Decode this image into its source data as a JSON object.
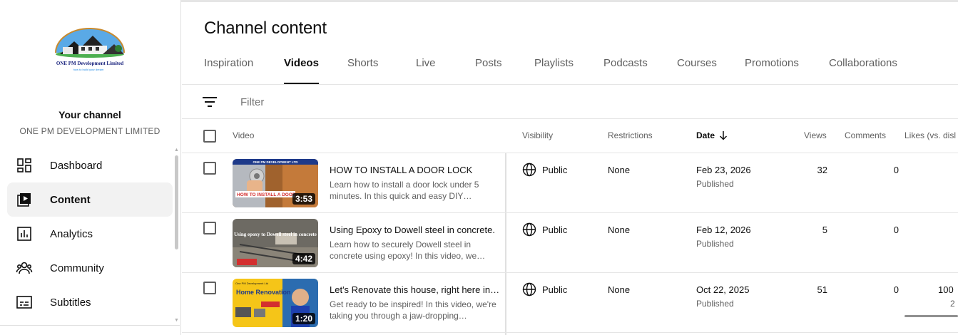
{
  "sidebar": {
    "logo_text": "ONE PM Development Limited",
    "logo_tagline": "how to build your dream",
    "your_channel_label": "Your channel",
    "channel_name": "ONE PM DEVELOPMENT LIMITED",
    "items": [
      {
        "label": "Dashboard",
        "icon": "dashboard-icon",
        "active": false
      },
      {
        "label": "Content",
        "icon": "content-icon",
        "active": true
      },
      {
        "label": "Analytics",
        "icon": "analytics-icon",
        "active": false
      },
      {
        "label": "Community",
        "icon": "community-icon",
        "active": false
      },
      {
        "label": "Subtitles",
        "icon": "subtitles-icon",
        "active": false
      }
    ]
  },
  "main": {
    "title": "Channel content",
    "tabs": [
      {
        "label": "Inspiration",
        "active": false
      },
      {
        "label": "Videos",
        "active": true
      },
      {
        "label": "Shorts",
        "active": false
      },
      {
        "label": "Live",
        "active": false
      },
      {
        "label": "Posts",
        "active": false
      },
      {
        "label": "Playlists",
        "active": false
      },
      {
        "label": "Podcasts",
        "active": false
      },
      {
        "label": "Courses",
        "active": false
      },
      {
        "label": "Promotions",
        "active": false
      },
      {
        "label": "Collaborations",
        "active": false
      }
    ],
    "filter": {
      "placeholder": "Filter"
    },
    "table": {
      "headers": {
        "video": "Video",
        "visibility": "Visibility",
        "restrictions": "Restrictions",
        "date": "Date",
        "views": "Views",
        "comments": "Comments",
        "likes": "Likes (vs. disl"
      },
      "rows": [
        {
          "title": "HOW TO INSTALL A DOOR LOCK",
          "description": "Learn how to install a door lock under 5 minutes. In this quick and easy DIY…",
          "duration": "3:53",
          "thumb_caption": "HOW TO INSTALL A DOOR",
          "thumb_header": "ONE PM DEVELOPMENT LTD",
          "visibility": "Public",
          "restrictions": "None",
          "date": "Feb 23, 2026",
          "status": "Published",
          "views": "32",
          "comments": "0",
          "likes": "",
          "likes_count": ""
        },
        {
          "title": "Using Epoxy to Dowell steel in concrete.",
          "description": "Learn how to securely Dowell steel in concrete using epoxy! In this video, we…",
          "duration": "4:42",
          "thumb_caption": "Using epoxy to Dowell steel in concrete",
          "thumb_header": "",
          "visibility": "Public",
          "restrictions": "None",
          "date": "Feb 12, 2026",
          "status": "Published",
          "views": "5",
          "comments": "0",
          "likes": "",
          "likes_count": ""
        },
        {
          "title": "Let's Renovate this house, right here in…",
          "description": "Get ready to be inspired! In this video, we're taking you through a jaw-dropping…",
          "duration": "1:20",
          "thumb_caption": "Home Renovation",
          "thumb_header": "One PM Development Ltd",
          "visibility": "Public",
          "restrictions": "None",
          "date": "Oct 22, 2025",
          "status": "Published",
          "views": "51",
          "comments": "0",
          "likes": "100",
          "likes_count": "2"
        }
      ]
    }
  },
  "colors": {
    "text_primary": "#0f0f0f",
    "text_secondary": "#606060",
    "active_bg": "#f2f2f2",
    "divider": "#e5e5e5"
  }
}
